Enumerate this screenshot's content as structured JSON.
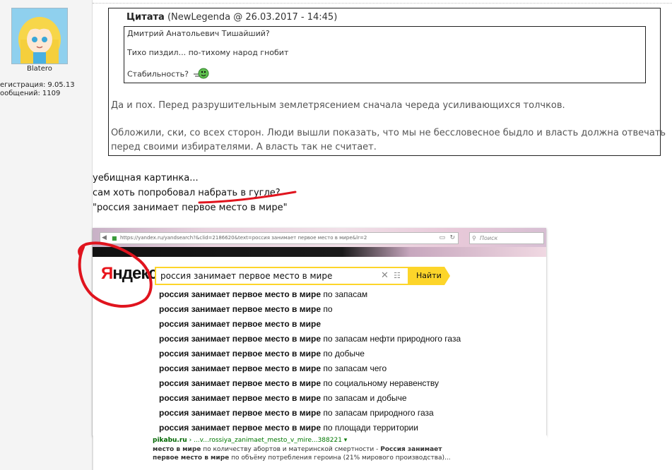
{
  "sidebar": {
    "username": "Blatero",
    "reg_label": "егистрация:",
    "reg_date": "9.05.13",
    "posts_label": "ообщений:",
    "posts_count": "1109"
  },
  "quote": {
    "title": "Цитата",
    "meta": "(NewLegenda @ 26.03.2017 - 14:45)",
    "inner_lines": [
      "Дмитрий Анатольевич Тишайший?",
      "Тихо пиздил... по-тихому народ гнобит",
      "Стабильность?"
    ],
    "body_lines": [
      "Да и пох. Перед разрушительным землетрясением сначала череда усиливающихся толчков.",
      "Обложили, ски, со всех сторон. Люди вышли показать, что мы не бессловесное быдло и власть должна отвечать",
      "перед своими избирателями. А власть так не считает."
    ]
  },
  "post": {
    "lines": [
      "уебищная картинка...",
      "сам хоть попробовал набрать в гугле?",
      "\"россия занимает первое место в мире\""
    ]
  },
  "screenshot": {
    "url": "https://yandex.ru/yandsearch?&clid=2186620&text=россия занимает первое место в мире&lr=2",
    "browser_search_placeholder": "Поиск",
    "logo_red": "Я",
    "logo_rest": "ндекс",
    "query": "россия занимает первое место в мире",
    "search_button": "Найти",
    "suggestions_bold": "россия занимает первое место в мире",
    "suggestions": [
      " по запасам",
      " по",
      "",
      " по запасам нефти природного газа",
      " по добыче",
      " по запасам чего",
      " по социальному неравенству",
      " по запасам и добыче",
      " по запасам природного газа",
      " по площади территории"
    ],
    "result_site": "pikabu.ru",
    "result_path": " › ...v...rossiya_zanimaet_mesto_v_mire...388221 ▾",
    "result_line1_a": "место в мире",
    "result_line1_b": " по количеству абортов и материнской смертности - ",
    "result_line1_c": "Россия занимает",
    "result_line2_a": "первое место в мире",
    "result_line2_b": " по объёму потребления героина (21% мирового производства)..."
  },
  "colors": {
    "yandex_yellow": "#fdd52a",
    "yandex_red": "#e8141b",
    "annotation_red": "#e0141e"
  }
}
